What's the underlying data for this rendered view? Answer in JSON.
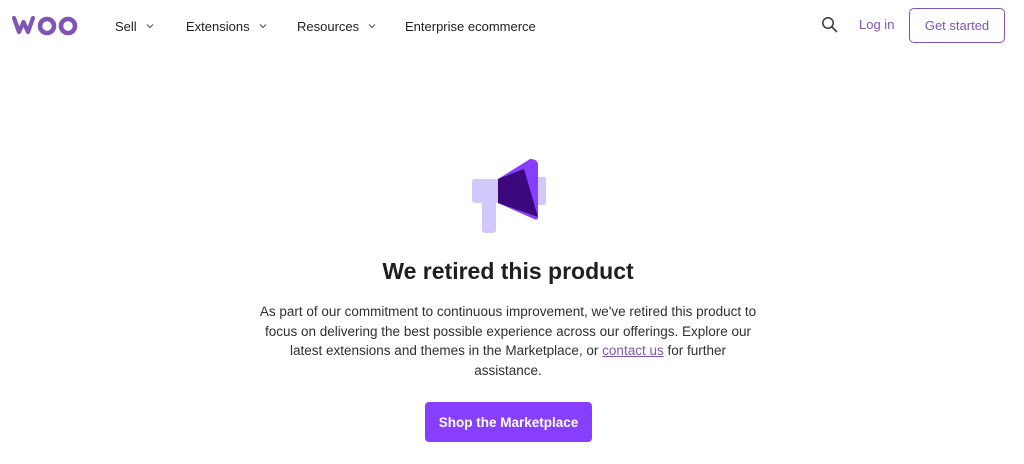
{
  "brand": {
    "logo_text": "WOO",
    "accent_color": "#7f54b3",
    "cta_color": "#873eff"
  },
  "nav": {
    "items": [
      {
        "label": "Sell",
        "has_dropdown": true
      },
      {
        "label": "Extensions",
        "has_dropdown": true
      },
      {
        "label": "Resources",
        "has_dropdown": true
      },
      {
        "label": "Enterprise ecommerce",
        "has_dropdown": false
      }
    ],
    "search_icon": "search-icon",
    "login_label": "Log in",
    "get_started_label": "Get started"
  },
  "main": {
    "icon": "megaphone-icon",
    "title": "We retired this product",
    "body_before_link": "As part of our commitment to continuous improvement, we've retired this product to focus on delivering the best possible experience across our offerings. Explore our latest extensions and themes in the Marketplace, or ",
    "link_label": "contact us",
    "body_after_link": " for further assistance.",
    "cta_label": "Shop the Marketplace"
  }
}
